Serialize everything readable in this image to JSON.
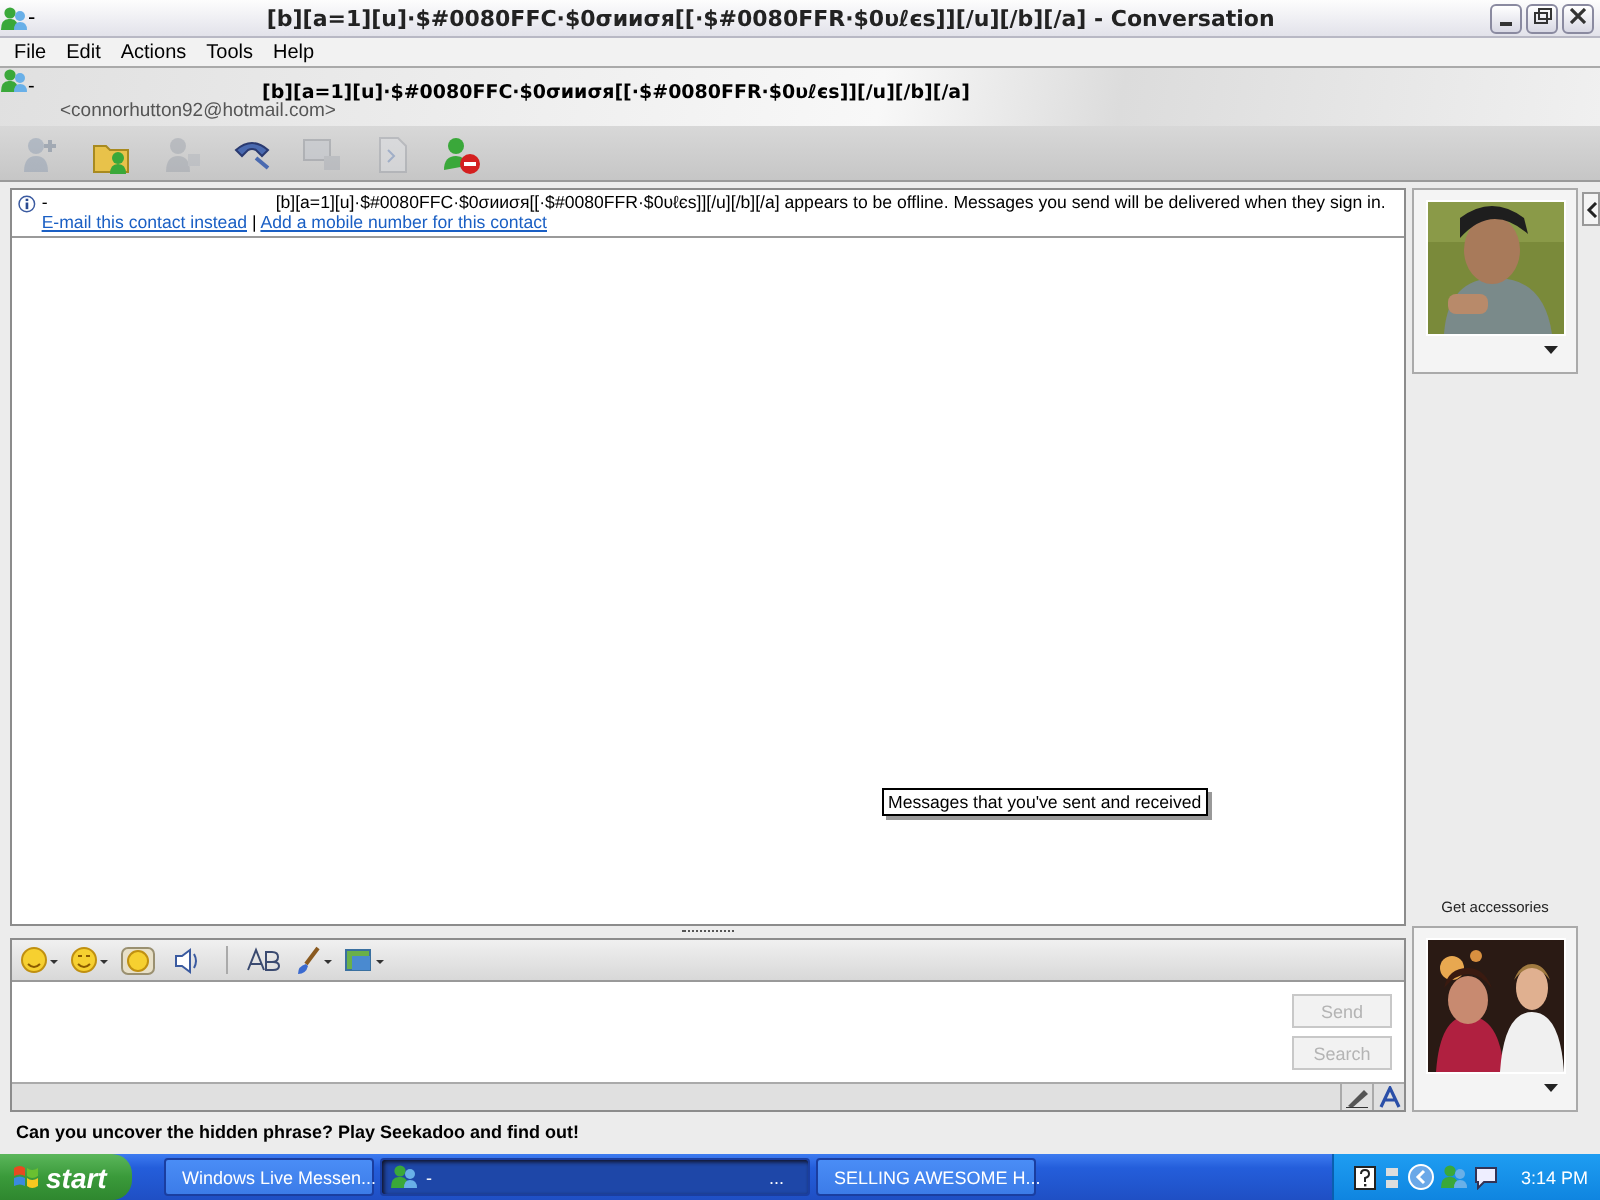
{
  "window": {
    "status": "-",
    "title": "[b][a=1][u]·$#0080FFC·$0σииσя[[·$#0080FFR·$0υℓєѕ]][/u][/b][/a] - Conversation"
  },
  "menu": [
    "File",
    "Edit",
    "Actions",
    "Tools",
    "Help"
  ],
  "contact": {
    "status": "-",
    "name": "[b][a=1][u]·$#0080FFC·$0σииσя[[·$#0080FFR·$0υℓєѕ]][/u][/b][/a]",
    "email": "<connorhutton92@hotmail.com>"
  },
  "toolbar": [
    {
      "kind": "invite",
      "disabled": true
    },
    {
      "kind": "share",
      "disabled": false
    },
    {
      "kind": "video",
      "disabled": true
    },
    {
      "kind": "call",
      "disabled": false
    },
    {
      "kind": "webcam",
      "disabled": true
    },
    {
      "kind": "activity",
      "disabled": true
    },
    {
      "kind": "block",
      "disabled": false
    }
  ],
  "notice": {
    "status": "-",
    "text": "[b][a=1][u]·$#0080FFC·$0σииσя[[·$#0080FFR·$0υℓєѕ]][/u][/b][/a] appears to be offline. Messages you send will be delivered when they sign in.",
    "links": [
      "E-mail this contact instead",
      "Add a mobile number for this contact"
    ],
    "separator": "|"
  },
  "tooltip": "Messages that you've sent and received",
  "format_toolbar": [
    {
      "kind": "emoticon"
    },
    {
      "kind": "wink"
    },
    {
      "kind": "face"
    },
    {
      "kind": "nudge"
    },
    {
      "kind": "divider"
    },
    {
      "kind": "font"
    },
    {
      "kind": "brush"
    },
    {
      "kind": "background"
    }
  ],
  "buttons": [
    {
      "label": "Send",
      "disabled": true
    },
    {
      "label": "Search",
      "disabled": true
    }
  ],
  "sidebar": {
    "accessories": "Get accessories"
  },
  "ad": "Can you uncover the hidden phrase?  Play Seekadoo and find out!",
  "taskbar": {
    "start": "start",
    "tasks": [
      {
        "kind": "messenger",
        "label": "Windows Live Messen...",
        "selected": false
      },
      {
        "kind": "conversation",
        "label": "-",
        "trail": "...",
        "selected": true
      },
      {
        "kind": "browser",
        "label": "SELLING AWESOME H...",
        "selected": false
      }
    ],
    "clock": "3:14 PM"
  }
}
